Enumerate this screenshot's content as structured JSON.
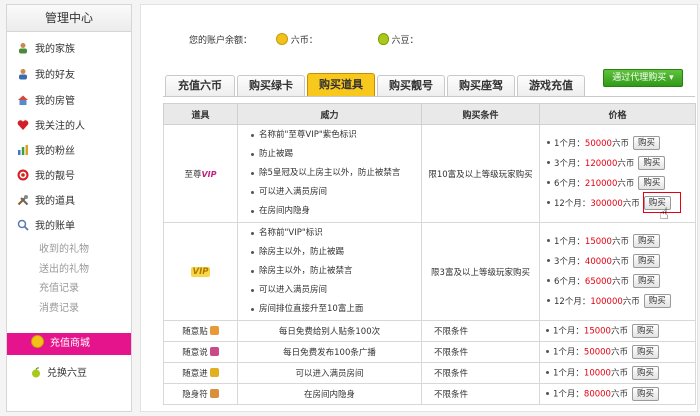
{
  "sidebar": {
    "title": "管理中心",
    "items": [
      {
        "label": "我的家族",
        "icon": "family-icon"
      },
      {
        "label": "我的好友",
        "icon": "friends-icon"
      },
      {
        "label": "我的房管",
        "icon": "house-icon"
      },
      {
        "label": "我关注的人",
        "icon": "heart-icon"
      },
      {
        "label": "我的粉丝",
        "icon": "chart-icon"
      },
      {
        "label": "我的靓号",
        "icon": "target-icon"
      },
      {
        "label": "我的道具",
        "icon": "tools-icon"
      },
      {
        "label": "我的账单",
        "icon": "magnifier-icon"
      }
    ],
    "subitems": [
      "收到的礼物",
      "送出的礼物",
      "充值记录",
      "消费记录"
    ],
    "active_item": "充值商城",
    "last_item": "兑换六豆"
  },
  "balance": {
    "label": "您的账户余额：",
    "coin_label": "六币：",
    "bean_label": "六豆："
  },
  "tabs": [
    "充值六币",
    "购买绿卡",
    "购买道具",
    "购买靓号",
    "购买座驾",
    "游戏充值"
  ],
  "active_tab": "购买道具",
  "agent_button": "通过代理购买 ▾",
  "table": {
    "headers": [
      "道具",
      "威力",
      "购买条件",
      "价格"
    ],
    "buy_label": "购买",
    "rows": [
      {
        "item": "至尊",
        "item_tag": "VIP",
        "powers": [
          "名称前\"至尊VIP\"紫色标识",
          "防止被踢",
          "除5皇冠及以上房主以外，防止被禁言",
          "可以进入满员房间",
          "在房间内隐身"
        ],
        "condition": "限10富及以上等级玩家购买",
        "prices": [
          {
            "period": "1个月：",
            "amount": "50000",
            "unit": "六币"
          },
          {
            "period": "3个月：",
            "amount": "120000",
            "unit": "六币"
          },
          {
            "period": "6个月：",
            "amount": "210000",
            "unit": "六币"
          },
          {
            "period": "12个月：",
            "amount": "300000",
            "unit": "六币"
          }
        ]
      },
      {
        "item": "",
        "item_tag": "VIP",
        "powers": [
          "名称前\"VIP\"标识",
          "除房主以外，防止被踢",
          "除房主以外，防止被禁言",
          "可以进入满员房间",
          "房间排位直接升至10富上面"
        ],
        "condition": "限3富及以上等级玩家购买",
        "prices": [
          {
            "period": "1个月：",
            "amount": "15000",
            "unit": "六币"
          },
          {
            "period": "3个月：",
            "amount": "40000",
            "unit": "六币"
          },
          {
            "period": "6个月：",
            "amount": "65000",
            "unit": "六币"
          },
          {
            "period": "12个月：",
            "amount": "100000",
            "unit": "六币"
          }
        ]
      },
      {
        "item": "随意贴",
        "powers": [
          "每日免费给别人贴条100次"
        ],
        "condition": "不限条件",
        "price": {
          "period": "1个月：",
          "amount": "15000",
          "unit": "六币"
        }
      },
      {
        "item": "随意说",
        "powers": [
          "每日免费发布100条广播"
        ],
        "condition": "不限条件",
        "price": {
          "period": "1个月：",
          "amount": "50000",
          "unit": "六币"
        }
      },
      {
        "item": "随意进",
        "powers": [
          "可以进入满员房间"
        ],
        "condition": "不限条件",
        "price": {
          "period": "1个月：",
          "amount": "10000",
          "unit": "六币"
        }
      },
      {
        "item": "隐身符",
        "powers": [
          "在房间内隐身"
        ],
        "condition": "不限条件",
        "price": {
          "period": "1个月：",
          "amount": "80000",
          "unit": "六币"
        }
      }
    ]
  }
}
